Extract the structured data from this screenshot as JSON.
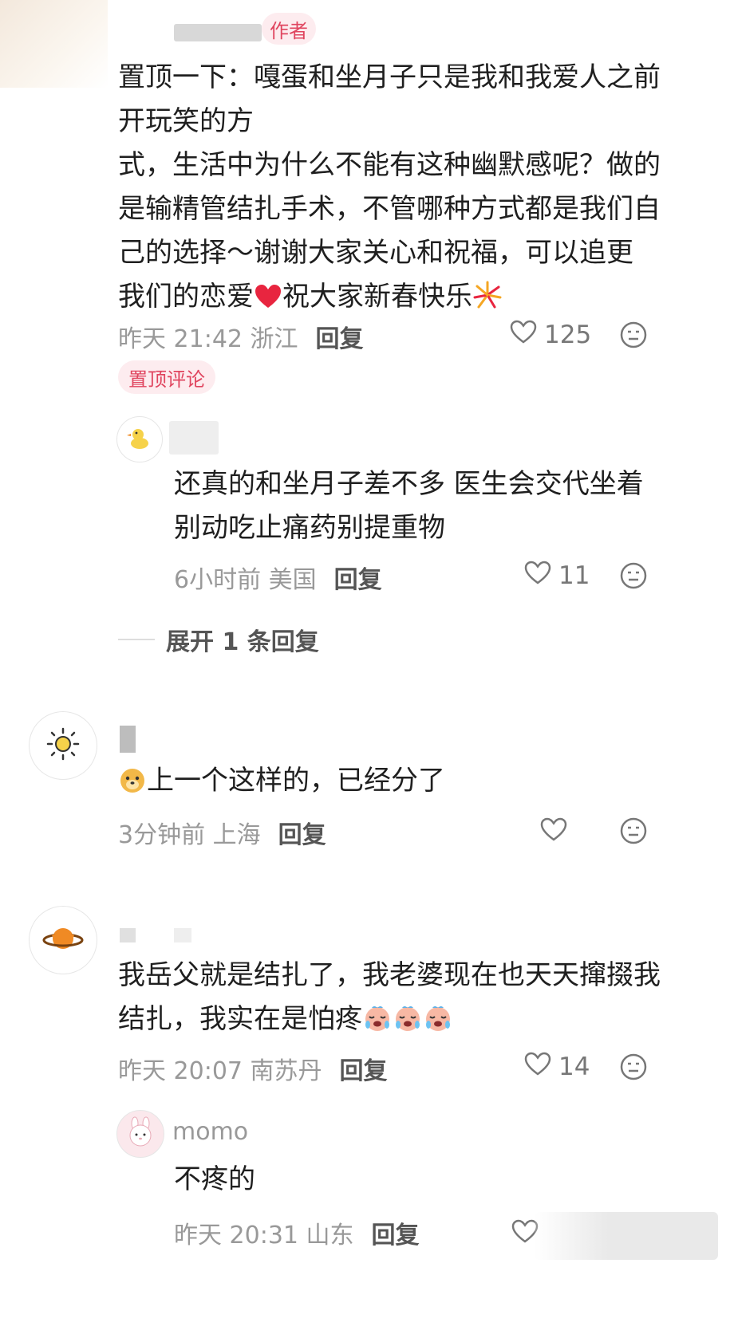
{
  "top_comment": {
    "badge": "作者",
    "text_line1": "置顶一下：嘎蛋和坐月子只是我和我爱人之前",
    "text_line2": "开玩笑的方",
    "text_line3": "式，生活中为什么不能有这种幽默感呢？做的",
    "text_line4": "是输精管结扎手术，不管哪种方式都是我们自",
    "text_line5": "己的选择～谢谢大家关心和祝福，可以追更",
    "text_line6a": "我们的恋爱",
    "text_line6b": "祝大家新春快乐",
    "time": "昨天 21:42 浙江",
    "reply": "回复",
    "likes": "125",
    "pinned_label": "置顶评论"
  },
  "reply_1": {
    "text_line1": "还真的和坐月子差不多 医生会交代坐着",
    "text_line2": "别动吃止痛药别提重物",
    "time": "6小时前 美国",
    "reply": "回复",
    "likes": "11",
    "expand": "展开 1 条回复"
  },
  "comment_2": {
    "text": "上一个这样的，已经分了",
    "time": "3分钟前 上海",
    "reply": "回复"
  },
  "comment_3": {
    "text_line1": "我岳父就是结扎了，我老婆现在也天天撺掇我",
    "text_line2": "结扎，我实在是怕疼",
    "time": "昨天 20:07 南苏丹",
    "reply": "回复",
    "likes": "14"
  },
  "reply_3": {
    "user": "momo",
    "text": "不疼的",
    "time": "昨天 20:31 山东",
    "reply": "回复"
  },
  "colors": {
    "accent_pink": "#e0455f",
    "meta_gray": "#999999",
    "heart_red": "#e8253f"
  },
  "icons": [
    "heart-outline-icon",
    "emoji-face-icon",
    "red-heart-icon",
    "fireworks-icon",
    "crying-face-icon",
    "sun-icon",
    "planet-icon",
    "duck-icon"
  ]
}
